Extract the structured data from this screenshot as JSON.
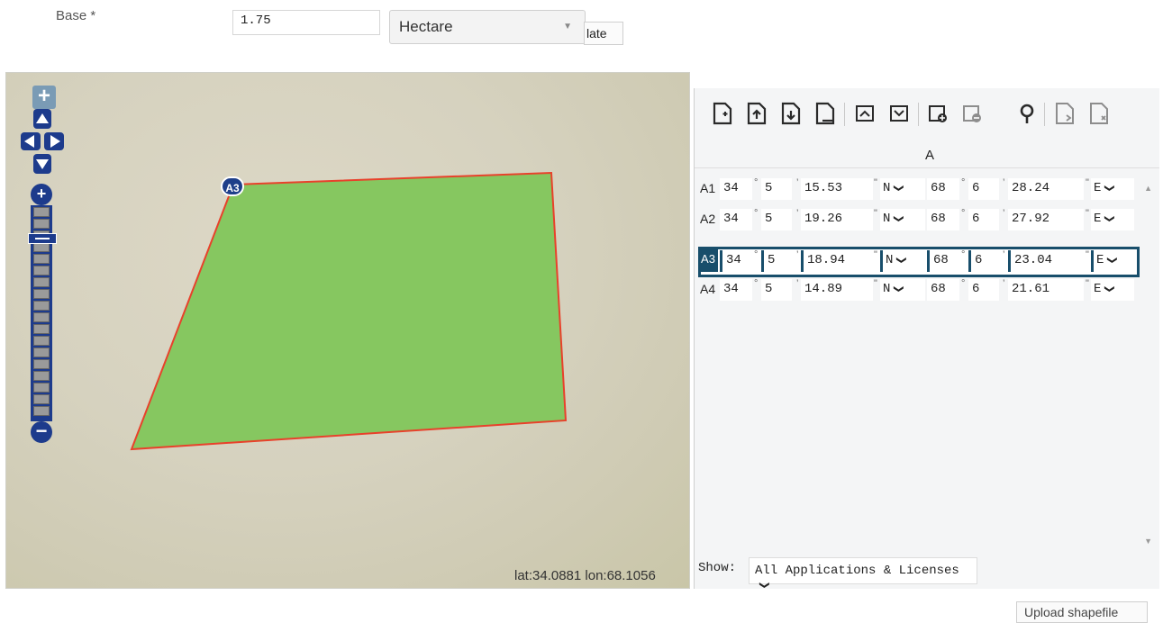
{
  "form": {
    "base_label": "Base *",
    "base_value": "1.75",
    "unit_selected": "Hectare",
    "calc_label": "late"
  },
  "map": {
    "vertex_label": "A3",
    "coords_text": "lat:34.0881 lon:68.1056",
    "polygon_fill": "#86c760",
    "polygon_stroke": "#e8412b"
  },
  "panel": {
    "column_header": "A",
    "rows": [
      {
        "label": "A1",
        "lat_deg": "34",
        "lat_min": "5",
        "lat_sec": "15.53",
        "lat_dir": "N",
        "lon_deg": "68",
        "lon_min": "6",
        "lon_sec": "28.24",
        "lon_dir": "E"
      },
      {
        "label": "A2",
        "lat_deg": "34",
        "lat_min": "5",
        "lat_sec": "19.26",
        "lat_dir": "N",
        "lon_deg": "68",
        "lon_min": "6",
        "lon_sec": "27.92",
        "lon_dir": "E"
      },
      {
        "label": "A3",
        "lat_deg": "34",
        "lat_min": "5",
        "lat_sec": "18.94",
        "lat_dir": "N",
        "lon_deg": "68",
        "lon_min": "6",
        "lon_sec": "23.04",
        "lon_dir": "E"
      },
      {
        "label": "A4",
        "lat_deg": "34",
        "lat_min": "5",
        "lat_sec": "14.89",
        "lat_dir": "N",
        "lon_deg": "68",
        "lon_min": "6",
        "lon_sec": "21.61",
        "lon_dir": "E"
      }
    ],
    "selected_row": "A3",
    "show_label": "Show:",
    "show_selected": "All Applications & Licenses"
  },
  "footer": {
    "upload_label": "Upload shapefile"
  },
  "colors": {
    "selected_row_border": "#184e6b",
    "map_controls": "#1d3b8c"
  }
}
